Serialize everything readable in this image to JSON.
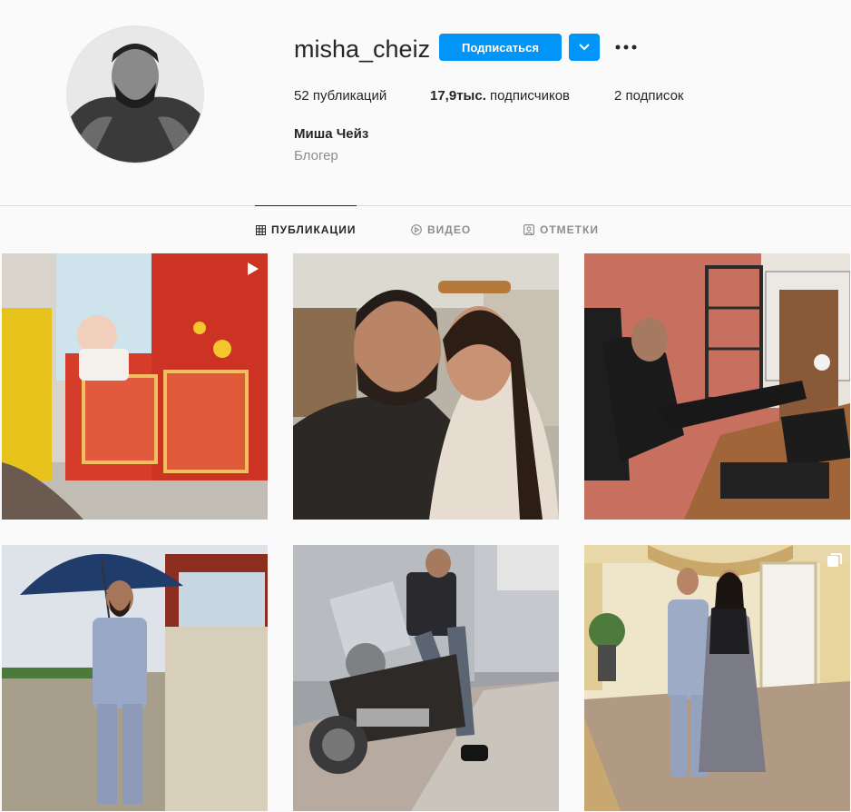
{
  "profile": {
    "username": "misha_cheiz",
    "follow_label": "Подписаться",
    "full_name": "Миша Чейз",
    "category": "Блогер",
    "avatar_icon": "profile-photo"
  },
  "stats": {
    "posts_count": "52",
    "posts_label": "публикаций",
    "followers_count": "17,9тыс.",
    "followers_label": "подписчиков",
    "following_count": "2",
    "following_label": "подписок"
  },
  "tabs": [
    {
      "label": "ПУБЛИКАЦИИ",
      "icon": "grid-icon",
      "active": true
    },
    {
      "label": "ВИДЕО",
      "icon": "play-icon",
      "active": false
    },
    {
      "label": "ОТМЕТКИ",
      "icon": "tag-icon",
      "active": false
    }
  ],
  "posts": [
    {
      "id": "p1",
      "badge": "video-icon"
    },
    {
      "id": "p2",
      "badge": ""
    },
    {
      "id": "p3",
      "badge": ""
    },
    {
      "id": "p4",
      "badge": ""
    },
    {
      "id": "p5",
      "badge": ""
    },
    {
      "id": "p6",
      "badge": "carousel-icon"
    }
  ],
  "colors": {
    "accent": "#0095f6",
    "text": "#262626",
    "muted": "#8e8e8e",
    "background": "#fafafa",
    "divider": "#dbdbdb"
  }
}
